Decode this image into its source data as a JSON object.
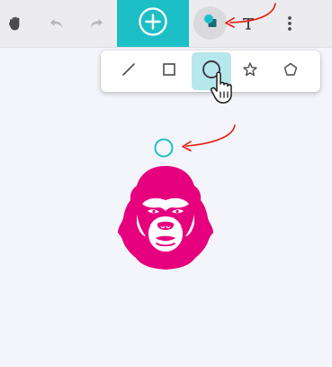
{
  "toolbar": {
    "tools": [
      {
        "name": "pan",
        "icon": "hand-icon"
      },
      {
        "name": "undo",
        "icon": "undo-icon"
      },
      {
        "name": "redo",
        "icon": "redo-icon"
      },
      {
        "name": "add",
        "icon": "plus-circle-icon"
      },
      {
        "name": "shapes",
        "icon": "shapes-icon"
      },
      {
        "name": "text",
        "icon": "text-icon"
      },
      {
        "name": "more",
        "icon": "more-vertical-icon"
      }
    ]
  },
  "shapes_popover": {
    "options": [
      {
        "name": "line",
        "icon": "line-icon"
      },
      {
        "name": "rectangle",
        "icon": "square-icon"
      },
      {
        "name": "circle",
        "icon": "circle-icon",
        "selected": true
      },
      {
        "name": "star",
        "icon": "star-icon"
      },
      {
        "name": "pentagon",
        "icon": "pentagon-icon"
      }
    ]
  },
  "canvas": {
    "objects": [
      {
        "type": "circle",
        "color": "#1dbfc7"
      },
      {
        "type": "image",
        "icon": "gorilla-icon",
        "color": "#e6007e"
      }
    ]
  },
  "colors": {
    "accent": "#1dbfc7",
    "selected_bg": "#b6e7ec",
    "annotation_arrow": "#e8190c",
    "gorilla": "#e6007e"
  }
}
